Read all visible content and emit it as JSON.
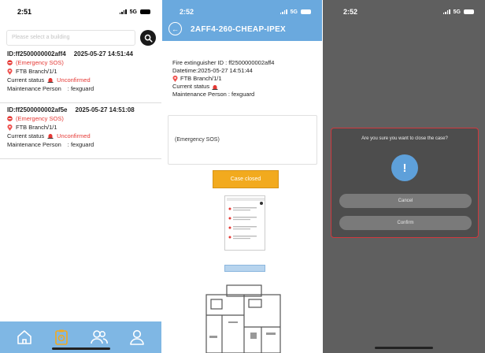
{
  "panel1": {
    "time": "2:51",
    "network": "5G",
    "search_placeholder": "Please select a building",
    "cards": [
      {
        "id_line": "ID:ff2500000002aff4",
        "datetime": "2025-05-27 14:51:44",
        "alert": "(Emergency SOS)",
        "location": "FTB Branch/1/1",
        "status_label": "Current status",
        "status_value": "Unconfirmed",
        "maint_label": "Maintenance Person",
        "maint_value": ": fexguard"
      },
      {
        "id_line": "ID:ff2500000002af5e",
        "datetime": "2025-05-27 14:51:08",
        "alert": "(Emergency SOS)",
        "location": "FTB Branch/1/1",
        "status_label": "Current status",
        "status_value": "Unconfirmed",
        "maint_label": "Maintenance Person",
        "maint_value": ": fexguard"
      }
    ],
    "tabs": [
      {
        "name": "home-icon"
      },
      {
        "name": "alarm-list-icon"
      },
      {
        "name": "users-icon"
      },
      {
        "name": "user-icon"
      }
    ]
  },
  "panel2": {
    "time": "2:52",
    "network": "5G",
    "title": "2AFF4-260-CHEAP-IPEX",
    "extinguisher": "Fire extinguisher ID : ff2500000002aff4",
    "datetime": "Datetime:2025-05-27 14:51:44",
    "location": "FTB Branch/1/1",
    "status_label": "Current status",
    "maint": "Maintenance Person   : fexguard",
    "sos_text": "(Emergency SOS)",
    "close_button": "Case closed"
  },
  "panel3": {
    "time": "2:52",
    "network": "5G",
    "question": "Are you sure you want to close the case?",
    "alert_glyph": "!",
    "cancel": "Cancel",
    "confirm": "Confirm"
  },
  "colors": {
    "accent_blue": "#6aa9de",
    "tabbar_blue": "#7fb7e4",
    "alert_red": "#e53935",
    "close_orange": "#f2aa1e",
    "dialog_border": "#d0383e"
  }
}
